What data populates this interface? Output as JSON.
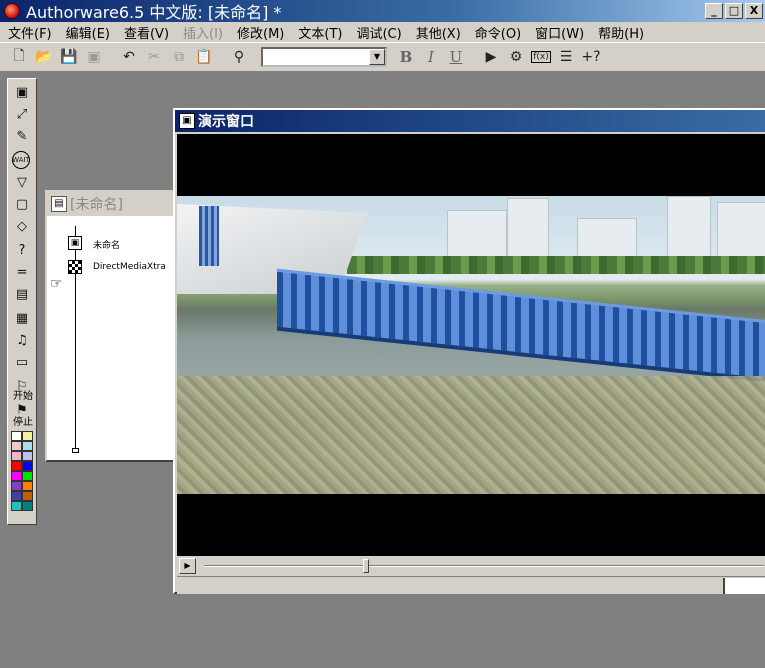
{
  "window": {
    "title": "Authorware6.5 中文版: [未命名] *",
    "buttons": [
      "_",
      "□",
      "X"
    ]
  },
  "menubar": {
    "items": [
      {
        "label": "文件(F)",
        "enabled": true
      },
      {
        "label": "编辑(E)",
        "enabled": true
      },
      {
        "label": "查看(V)",
        "enabled": true
      },
      {
        "label": "插入(I)",
        "enabled": false
      },
      {
        "label": "修改(M)",
        "enabled": true
      },
      {
        "label": "文本(T)",
        "enabled": true
      },
      {
        "label": "调试(C)",
        "enabled": true
      },
      {
        "label": "其他(X)",
        "enabled": true
      },
      {
        "label": "命令(O)",
        "enabled": true
      },
      {
        "label": "窗口(W)",
        "enabled": true
      },
      {
        "label": "帮助(H)",
        "enabled": true
      }
    ]
  },
  "toolbar": {
    "font_select_value": "",
    "bold": "B",
    "italic": "I",
    "underline": "U",
    "functions_label": "f(x)",
    "help_label": "+?"
  },
  "palette": {
    "flag_start": "开始",
    "flag_stop": "停止",
    "swatch_colors": [
      "#ffffff",
      "#f4f0a0",
      "#f0c8c8",
      "#a8e0e8",
      "#f4b4c8",
      "#c0c0f0",
      "#ff0000",
      "#0000ff",
      "#ff00ff",
      "#00e000",
      "#8040c0",
      "#ff8000",
      "#4040a0",
      "#c06000",
      "#20c0c0",
      "#008080"
    ]
  },
  "flowline_window": {
    "title": "[未命名]",
    "nodes": [
      {
        "label": "未命名"
      },
      {
        "label": "DirectMediaXtra"
      }
    ]
  },
  "presentation_window": {
    "title": "演示窗口",
    "playback": {
      "position_fraction": 0.29
    }
  }
}
